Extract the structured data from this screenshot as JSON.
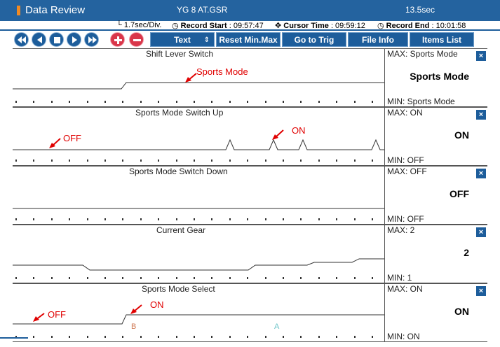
{
  "window": {
    "title": "Data Review",
    "file": "YG 8 AT.GSR",
    "duration": "13.5sec"
  },
  "info": {
    "division": "1.7sec/Div.",
    "record_start_label": "Record Start",
    "record_start_value": ": 09:57:47",
    "cursor_time_label": "Cursor Time",
    "cursor_time_value": ": 09:59:12",
    "record_end_label": "Record End",
    "record_end_value": ": 10:01:58"
  },
  "toolbar": {
    "buttons": [
      {
        "name": "first",
        "icon": "rewind-icon"
      },
      {
        "name": "prev",
        "icon": "previous-icon"
      },
      {
        "name": "stop",
        "icon": "stop-icon"
      },
      {
        "name": "next",
        "icon": "next-icon"
      },
      {
        "name": "last",
        "icon": "fast-forward-icon"
      },
      {
        "name": "zoom-in",
        "icon": "plus-icon"
      },
      {
        "name": "zoom-out",
        "icon": "minus-icon"
      }
    ],
    "text_label": "Text",
    "reset_label": "Reset Min.Max",
    "trig_label": "Go to Trig",
    "fileinfo_label": "File Info",
    "items_label": "Items List"
  },
  "panels": [
    {
      "title": "Shift Lever Switch",
      "max": "MAX: Sports Mode",
      "value": "Sports Mode",
      "min": "MIN: Sports Mode",
      "annotation": "Sports Mode"
    },
    {
      "title": "Sports Mode Switch Up",
      "max": "MAX: ON",
      "value": "ON",
      "min": "MIN: OFF",
      "annotation_off": "OFF",
      "annotation_on": "ON"
    },
    {
      "title": "Sports Mode Switch Down",
      "max": "MAX: OFF",
      "value": "OFF",
      "min": "MIN: OFF"
    },
    {
      "title": "Current Gear",
      "max": "MAX: 2",
      "value": "2",
      "min": "MIN: 1"
    },
    {
      "title": "Sports Mode Select",
      "max": "MAX: ON",
      "value": "ON",
      "min": "MIN: ON",
      "annotation_off": "OFF",
      "annotation_on": "ON"
    }
  ],
  "cursors": {
    "b_label": "B",
    "a_label": "A"
  },
  "close_glyph": "×",
  "colors": {
    "titlebar": "#24639f",
    "button": "#1d5d9b",
    "annotation": "#e00000",
    "cursor_b": "#d07a55",
    "cursor_a": "#8ad4d8"
  }
}
